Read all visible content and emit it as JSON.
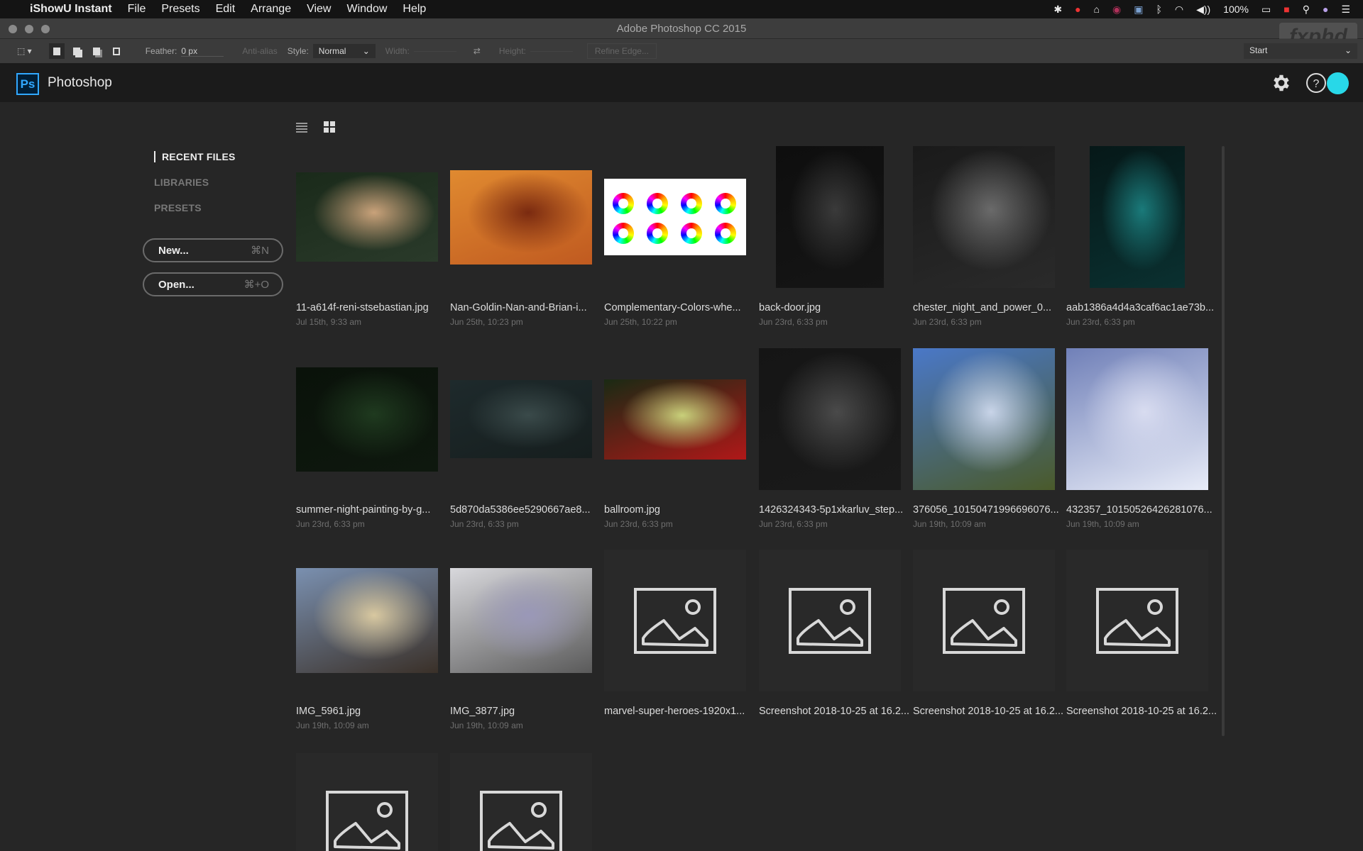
{
  "menubar": {
    "app_name": "iShowU Instant",
    "items": [
      "File",
      "Presets",
      "Edit",
      "Arrange",
      "View",
      "Window",
      "Help"
    ],
    "battery": "100%",
    "tray_icons": [
      "avast-icon",
      "creative-cloud-icon",
      "wifi-lock-icon",
      "blackberry-icon",
      "screen-icon",
      "bluetooth-icon",
      "wifi-icon",
      "volume-icon",
      "battery-icon",
      "canada-flag-icon",
      "search-icon",
      "siri-icon",
      "list-icon"
    ]
  },
  "window": {
    "title": "Adobe Photoshop CC 2015"
  },
  "watermark": "fxphd",
  "options_bar": {
    "feather_label": "Feather:",
    "feather_value": "0 px",
    "antialias_label": "Anti-alias",
    "style_label": "Style:",
    "style_value": "Normal",
    "width_label": "Width:",
    "height_label": "Height:",
    "refine_edge": "Refine Edge...",
    "workspace": "Start"
  },
  "header": {
    "logo": "Ps",
    "title": "Photoshop"
  },
  "sidebar": {
    "nav": [
      {
        "label": "RECENT FILES",
        "active": true
      },
      {
        "label": "LIBRARIES",
        "active": false
      },
      {
        "label": "PRESETS",
        "active": false
      }
    ],
    "buttons": [
      {
        "label": "New...",
        "shortcut": "⌘N"
      },
      {
        "label": "Open...",
        "shortcut": "⌘+O"
      }
    ]
  },
  "colors": {
    "accent": "#31a8ff",
    "avatar": "#28d8e8",
    "background": "#262626"
  },
  "files": [
    {
      "name": "11-a614f-reni-stsebastian.jpg",
      "date": "Jul 15th, 9:33 am",
      "colors": [
        "#1a2a1a",
        "#c9a27a",
        "#2a3a2a"
      ]
    },
    {
      "name": "Nan-Goldin-Nan-and-Brian-i...",
      "date": "Jun 25th, 10:23 pm",
      "colors": [
        "#e08a30",
        "#7a2a10",
        "#c05a20"
      ]
    },
    {
      "name": "Complementary-Colors-whe...",
      "date": "Jun 25th, 10:22 pm",
      "colors": [
        "#ffffff",
        "#f4f4f4",
        "#ffffff"
      ],
      "wheels": true
    },
    {
      "name": "back-door.jpg",
      "date": "Jun 23rd, 6:33 pm",
      "colors": [
        "#0e0e0e",
        "#3a3a3a",
        "#151515"
      ]
    },
    {
      "name": "chester_night_and_power_0...",
      "date": "Jun 23rd, 6:33 pm",
      "colors": [
        "#1a1a1a",
        "#6a6a6a",
        "#2a2a2a"
      ]
    },
    {
      "name": "aab1386a4d4a3caf6ac1ae73b...",
      "date": "Jun 23rd, 6:33 pm",
      "colors": [
        "#061818",
        "#1a7a7a",
        "#0a3030"
      ]
    },
    {
      "name": "summer-night-painting-by-g...",
      "date": "Jun 23rd, 6:33 pm",
      "colors": [
        "#0a120a",
        "#1f3a1f",
        "#0e180e"
      ]
    },
    {
      "name": "5d870da5386ee5290667ae8...",
      "date": "Jun 23rd, 6:33 pm",
      "colors": [
        "#1e2a2c",
        "#3a4a4a",
        "#161e1e"
      ]
    },
    {
      "name": "ballroom.jpg",
      "date": "Jun 23rd, 6:33 pm",
      "colors": [
        "#1a2a14",
        "#c8d07a",
        "#b01818"
      ]
    },
    {
      "name": "1426324343-5p1xkarluv_step...",
      "date": "Jun 23rd, 6:33 pm",
      "colors": [
        "#151515",
        "#4a4a4a",
        "#1a1a1a"
      ]
    },
    {
      "name": "376056_10150471996696076...",
      "date": "Jun 19th, 10:09 am",
      "colors": [
        "#4a78c8",
        "#c8d4e8",
        "#4a5a2a"
      ]
    },
    {
      "name": "432357_10150526426281076...",
      "date": "Jun 19th, 10:09 am",
      "colors": [
        "#7080b8",
        "#d8dcf0",
        "#e8ecf8"
      ]
    },
    {
      "name": "IMG_5961.jpg",
      "date": "Jun 19th, 10:09 am",
      "colors": [
        "#7a90b0",
        "#d8c8a0",
        "#3a3028"
      ]
    },
    {
      "name": "IMG_3877.jpg",
      "date": "Jun 19th, 10:09 am",
      "colors": [
        "#d8d8dc",
        "#9a98b8",
        "#5a5a5a"
      ]
    },
    {
      "name": "marvel-super-heroes-1920x1...",
      "date": "",
      "placeholder": true
    },
    {
      "name": "Screenshot 2018-10-25 at 16.2...",
      "date": "",
      "placeholder": true
    },
    {
      "name": "Screenshot 2018-10-25 at 16.2...",
      "date": "",
      "placeholder": true
    },
    {
      "name": "Screenshot 2018-10-25 at 16.2...",
      "date": "",
      "placeholder": true
    },
    {
      "name": "",
      "date": "",
      "placeholder": true
    },
    {
      "name": "",
      "date": "",
      "placeholder": true
    }
  ]
}
